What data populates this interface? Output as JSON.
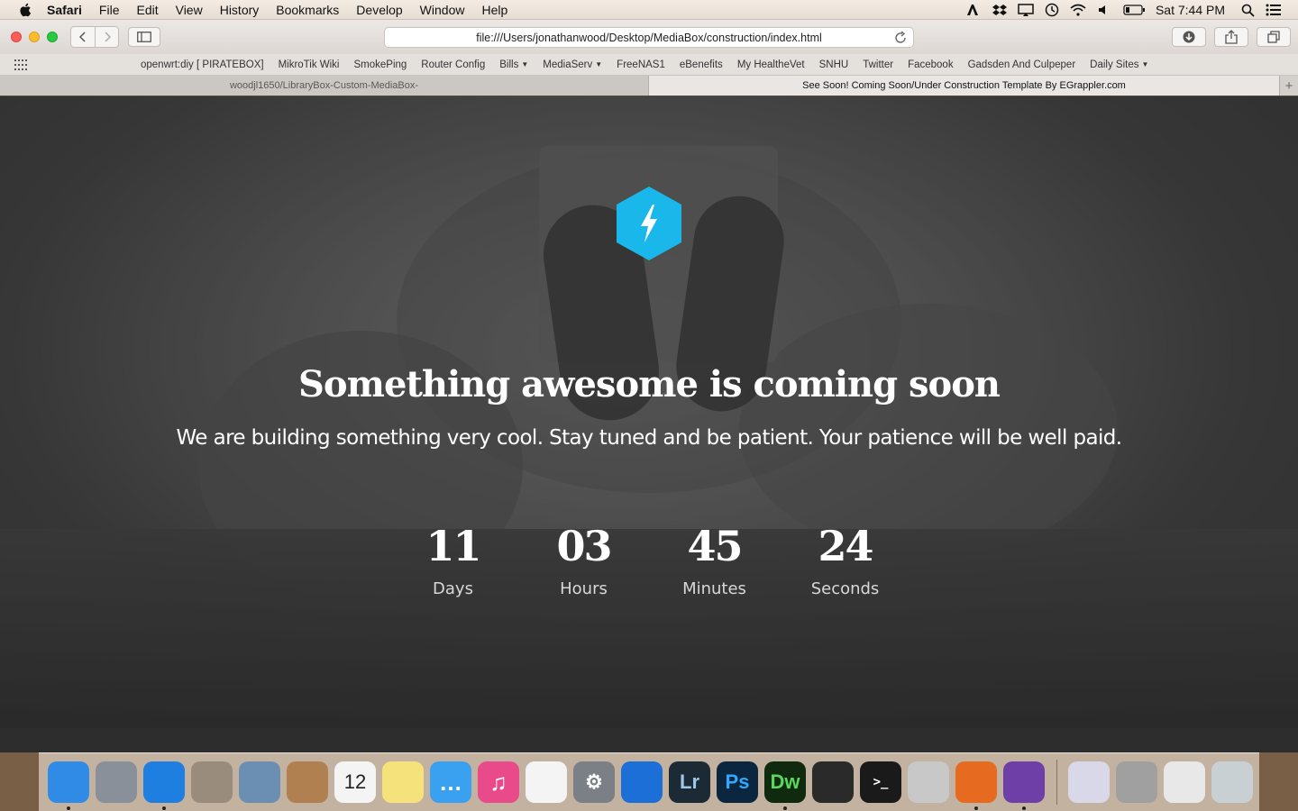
{
  "menubar": {
    "items": [
      "Safari",
      "File",
      "Edit",
      "View",
      "History",
      "Bookmarks",
      "Develop",
      "Window",
      "Help"
    ],
    "clock": "Sat 7:44 PM"
  },
  "toolbar": {
    "url": "file:///Users/jonathanwood/Desktop/MediaBox/construction/index.html"
  },
  "bookmarks": [
    {
      "label": "openwrt:diy [ PIRATEBOX]",
      "dropdown": false
    },
    {
      "label": "MikroTik Wiki",
      "dropdown": false
    },
    {
      "label": "SmokePing",
      "dropdown": false
    },
    {
      "label": "Router Config",
      "dropdown": false
    },
    {
      "label": "Bills",
      "dropdown": true
    },
    {
      "label": "MediaServ",
      "dropdown": true
    },
    {
      "label": "FreeNAS1",
      "dropdown": false
    },
    {
      "label": "eBenefits",
      "dropdown": false
    },
    {
      "label": "My HealtheVet",
      "dropdown": false
    },
    {
      "label": "SNHU",
      "dropdown": false
    },
    {
      "label": "Twitter",
      "dropdown": false
    },
    {
      "label": "Facebook",
      "dropdown": false
    },
    {
      "label": "Gadsden And Culpeper",
      "dropdown": false
    },
    {
      "label": "Daily Sites",
      "dropdown": true
    }
  ],
  "tabs": {
    "inactive": "woodjl1650/LibraryBox-Custom-MediaBox-",
    "active": "See Soon! Coming Soon/Under Construction Template By EGrappler.com",
    "new_tab": "+"
  },
  "page": {
    "headline": "Something awesome is coming soon",
    "subline": "We are building something very cool. Stay tuned and be patient. Your patience will be well paid.",
    "accent_color": "#1ab7ea",
    "logo_icon": "lightning-bolt-hexagon",
    "countdown": [
      {
        "value": "11",
        "label": "Days"
      },
      {
        "value": "03",
        "label": "Hours"
      },
      {
        "value": "45",
        "label": "Minutes"
      },
      {
        "value": "24",
        "label": "Seconds"
      }
    ]
  },
  "dock": {
    "apps": [
      {
        "name": "finder-icon",
        "glyph": "",
        "bg": "#2f8be6",
        "running": true
      },
      {
        "name": "launchpad-icon",
        "glyph": "",
        "bg": "#8a9099",
        "running": false
      },
      {
        "name": "safari-icon",
        "glyph": "",
        "bg": "#1f7fe0",
        "running": true
      },
      {
        "name": "calculator-icon",
        "glyph": "",
        "bg": "#9a8c7c",
        "running": false
      },
      {
        "name": "preview-icon",
        "glyph": "",
        "bg": "#6b8fb3",
        "running": false
      },
      {
        "name": "contacts-icon",
        "glyph": "",
        "bg": "#b08050",
        "running": false
      },
      {
        "name": "calendar-icon",
        "glyph": "12",
        "bg": "#f4f4f4",
        "running": false
      },
      {
        "name": "notes-icon",
        "glyph": "",
        "bg": "#f6e27a",
        "running": false
      },
      {
        "name": "messages-icon",
        "glyph": "…",
        "bg": "#3aa0f0",
        "running": false
      },
      {
        "name": "itunes-icon",
        "glyph": "♫",
        "bg": "#e94a8a",
        "running": false
      },
      {
        "name": "photos-icon",
        "glyph": "",
        "bg": "#f4f4f4",
        "running": false
      },
      {
        "name": "system-preferences-icon",
        "glyph": "⚙",
        "bg": "#7b7f86",
        "running": false
      },
      {
        "name": "1password-icon",
        "glyph": "",
        "bg": "#1c6fd6",
        "running": false
      },
      {
        "name": "lightroom-icon",
        "glyph": "Lr",
        "bg": "#1c2a36",
        "running": false
      },
      {
        "name": "photoshop-icon",
        "glyph": "Ps",
        "bg": "#0b2740",
        "running": false
      },
      {
        "name": "dreamweaver-icon",
        "glyph": "Dw",
        "bg": "#0f2a0f",
        "running": true
      },
      {
        "name": "photo-booth-icon",
        "glyph": "",
        "bg": "#2a2a2a",
        "running": false
      },
      {
        "name": "terminal-icon",
        "glyph": ">_",
        "bg": "#1a1a1a",
        "running": false
      },
      {
        "name": "migration-icon",
        "glyph": "",
        "bg": "#c8c8c8",
        "running": false
      },
      {
        "name": "firefox-icon",
        "glyph": "",
        "bg": "#e66a1f",
        "running": true
      },
      {
        "name": "github-icon",
        "glyph": "",
        "bg": "#6f3fa8",
        "running": true
      }
    ],
    "right": [
      {
        "name": "torrent-folder-icon",
        "glyph": "",
        "bg": "#d8d8e8"
      },
      {
        "name": "dreamweaver-doc-icon",
        "glyph": "",
        "bg": "#a0a0a0"
      },
      {
        "name": "downloads-stack-icon",
        "glyph": "",
        "bg": "#e8e8e8"
      },
      {
        "name": "trash-icon",
        "glyph": "",
        "bg": "#c8d0d4"
      }
    ]
  }
}
